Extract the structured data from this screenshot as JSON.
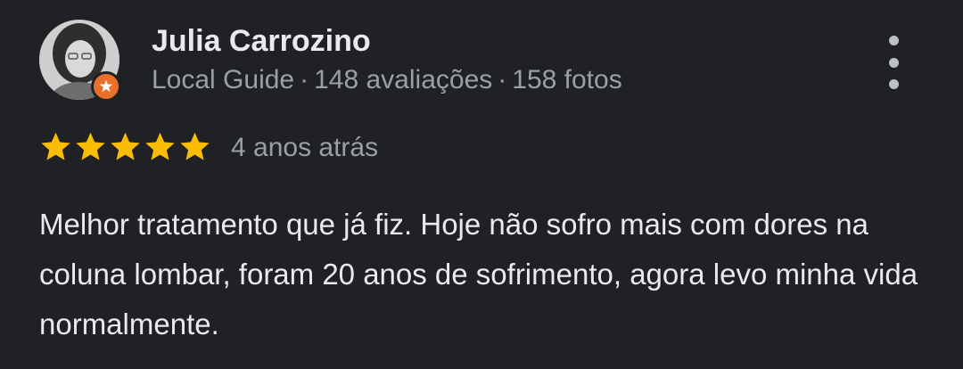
{
  "review": {
    "author_name": "Julia Carrozino",
    "author_badge": "Local Guide",
    "review_count": "148 avaliações",
    "photo_count": "158 fotos",
    "separator": "·",
    "rating": 5,
    "max_rating": 5,
    "time_ago": "4 anos atrás",
    "text": "Melhor tratamento que já fiz. Hoje não sofro mais com dores na coluna lombar, foram 20 anos de sofrimento, agora levo minha vida normalmente."
  },
  "icons": {
    "avatar": "user-avatar",
    "badge": "local-guide-star-icon",
    "menu": "more-vert-icon",
    "star": "star-icon"
  },
  "colors": {
    "background": "#202124",
    "primary_text": "#e8eaed",
    "secondary_text": "#9aa0a6",
    "star": "#fbbc04",
    "badge": "#e8702a"
  }
}
